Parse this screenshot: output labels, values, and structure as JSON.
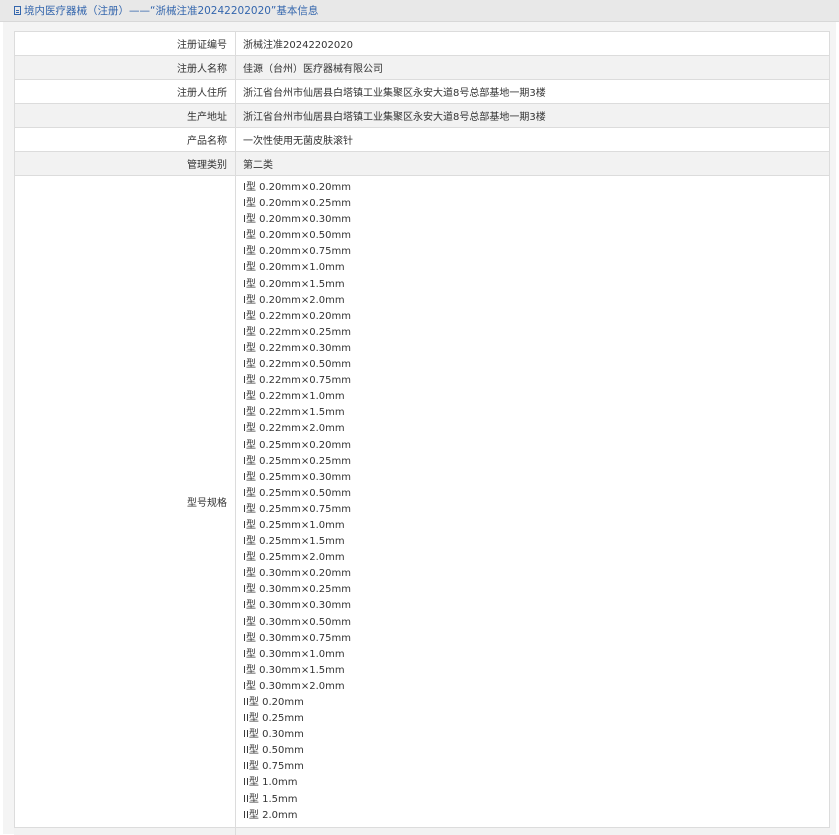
{
  "header": {
    "title": "境内医疗器械（注册）——“浙械注准20242202020”基本信息"
  },
  "rows": [
    {
      "label": "注册证编号",
      "value": "浙械注准20242202020"
    },
    {
      "label": "注册人名称",
      "value": "佳源（台州）医疗器械有限公司"
    },
    {
      "label": "注册人住所",
      "value": "浙江省台州市仙居县白塔镇工业集聚区永安大道8号总部基地一期3楼"
    },
    {
      "label": "生产地址",
      "value": "浙江省台州市仙居县白塔镇工业集聚区永安大道8号总部基地一期3楼"
    },
    {
      "label": "产品名称",
      "value": "一次性使用无菌皮肤滚针"
    },
    {
      "label": "管理类别",
      "value": "第二类"
    }
  ],
  "models": {
    "label": "型号规格",
    "items": [
      "I型 0.20mm×0.20mm",
      "I型 0.20mm×0.25mm",
      "I型 0.20mm×0.30mm",
      "I型 0.20mm×0.50mm",
      "I型 0.20mm×0.75mm",
      "I型 0.20mm×1.0mm",
      "I型 0.20mm×1.5mm",
      "I型 0.20mm×2.0mm",
      "I型 0.22mm×0.20mm",
      "I型 0.22mm×0.25mm",
      "I型 0.22mm×0.30mm",
      "I型 0.22mm×0.50mm",
      "I型 0.22mm×0.75mm",
      "I型 0.22mm×1.0mm",
      "I型 0.22mm×1.5mm",
      "I型 0.22mm×2.0mm",
      "I型 0.25mm×0.20mm",
      "I型 0.25mm×0.25mm",
      "I型 0.25mm×0.30mm",
      "I型 0.25mm×0.50mm",
      "I型 0.25mm×0.75mm",
      "I型 0.25mm×1.0mm",
      "I型 0.25mm×1.5mm",
      "I型 0.25mm×2.0mm",
      "I型 0.30mm×0.20mm",
      "I型 0.30mm×0.25mm",
      "I型 0.30mm×0.30mm",
      "I型 0.30mm×0.50mm",
      "I型 0.30mm×0.75mm",
      "I型 0.30mm×1.0mm",
      "I型 0.30mm×1.5mm",
      "I型 0.30mm×2.0mm",
      "II型 0.20mm",
      "II型 0.25mm",
      "II型 0.30mm",
      "II型 0.50mm",
      "II型 0.75mm",
      "II型 1.0mm",
      "II型 1.5mm",
      "II型 2.0mm"
    ]
  }
}
